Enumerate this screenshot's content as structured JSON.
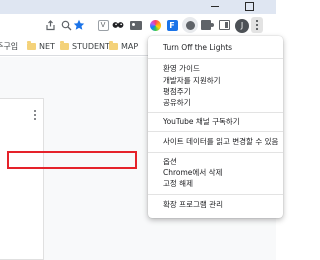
{
  "toolbar": {
    "avatar_letter": "J"
  },
  "extensions": {
    "v_label": "V",
    "f_label": "F"
  },
  "bookmarks": [
    {
      "label": "주구입"
    },
    {
      "label": "NET"
    },
    {
      "label": "STUDENT"
    },
    {
      "label": "MAP"
    }
  ],
  "menu": {
    "header": "Turn Off the Lights",
    "group1": [
      "환영 가이드",
      "개발자를 지원하기",
      "평점주기",
      "공유하기"
    ],
    "group2": [
      "YouTube 채널 구독하기"
    ],
    "group3": [
      "사이트 데이터를 읽고 변경할 수 있음"
    ],
    "group4": [
      "옵션",
      "Chrome에서 삭제",
      "고정 해제"
    ],
    "group5": [
      "확장 프로그램 관리"
    ]
  },
  "colors": {
    "highlight_border": "#e5222a",
    "titlebar": "#dfe6f2"
  }
}
